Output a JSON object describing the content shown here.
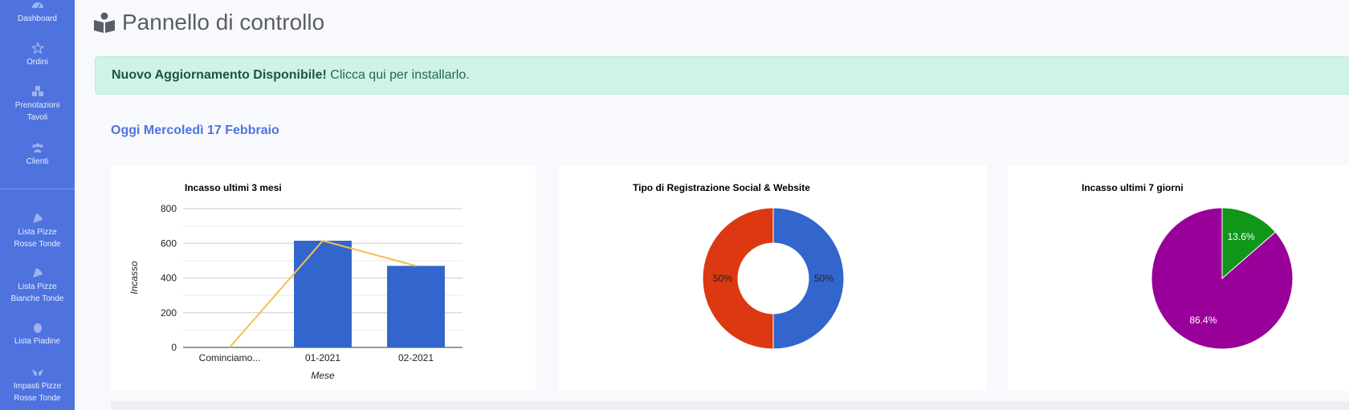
{
  "sidebar": {
    "items": [
      {
        "label": "Dashboard",
        "icon": "tachometer-icon"
      },
      {
        "label": "Ordini",
        "icon": "star-icon"
      },
      {
        "label": "Prenotazioni\nTavoli",
        "icon": "cubes-icon"
      },
      {
        "label": "Clienti",
        "icon": "users-icon"
      },
      {
        "label": "Lista Pizze\nRosse Tonde",
        "icon": "pizza-slice-icon"
      },
      {
        "label": "Lista Pizze\nBianche Tonde",
        "icon": "pizza-slice-icon"
      },
      {
        "label": "Lista Piadine",
        "icon": "egg-icon"
      },
      {
        "label": "Impasti Pizze\nRosse Tonde",
        "icon": "hands-icon"
      }
    ]
  },
  "header": {
    "title": "Pannello di controllo",
    "icon": "book-reader-icon"
  },
  "alert": {
    "strong": "Nuovo Aggiornamento Disponibile!",
    "text": " Clicca qui per installarlo."
  },
  "date_heading": "Oggi Mercoledì 17 Febbraio",
  "colors": {
    "sidebar": "#4e73df",
    "bar_blue": "#3366cc",
    "line_orange": "#f1c050",
    "donut_red": "#dc3912",
    "pie_green": "#109618",
    "pie_purple": "#990099",
    "alert_bg": "#d1f2e6"
  },
  "chart_data": [
    {
      "type": "bar",
      "title": "Incasso ultimi 3 mesi",
      "xlabel": "Mese",
      "ylabel": "Incasso",
      "categories": [
        "Cominciamo...",
        "01-2021",
        "02-2021"
      ],
      "series": [
        {
          "type": "bar",
          "values": [
            0,
            615,
            470
          ],
          "color": "#3366cc"
        },
        {
          "type": "line",
          "values": [
            0,
            615,
            470
          ],
          "color": "#f1c050"
        }
      ],
      "ylim": [
        0,
        800
      ],
      "yticks": [
        0,
        200,
        400,
        600,
        800
      ],
      "grid": true
    },
    {
      "type": "pie",
      "donut": true,
      "title": "Tipo di Registrazione Social & Website",
      "slices": [
        {
          "value": 50,
          "label": "50%",
          "color": "#3366cc"
        },
        {
          "value": 50,
          "label": "50%",
          "color": "#dc3912"
        }
      ]
    },
    {
      "type": "pie",
      "title": "Incasso ultimi 7 giorni",
      "slices": [
        {
          "value": 13.6,
          "label": "13.6%",
          "color": "#109618"
        },
        {
          "value": 86.4,
          "label": "86.4%",
          "color": "#990099"
        }
      ]
    }
  ]
}
